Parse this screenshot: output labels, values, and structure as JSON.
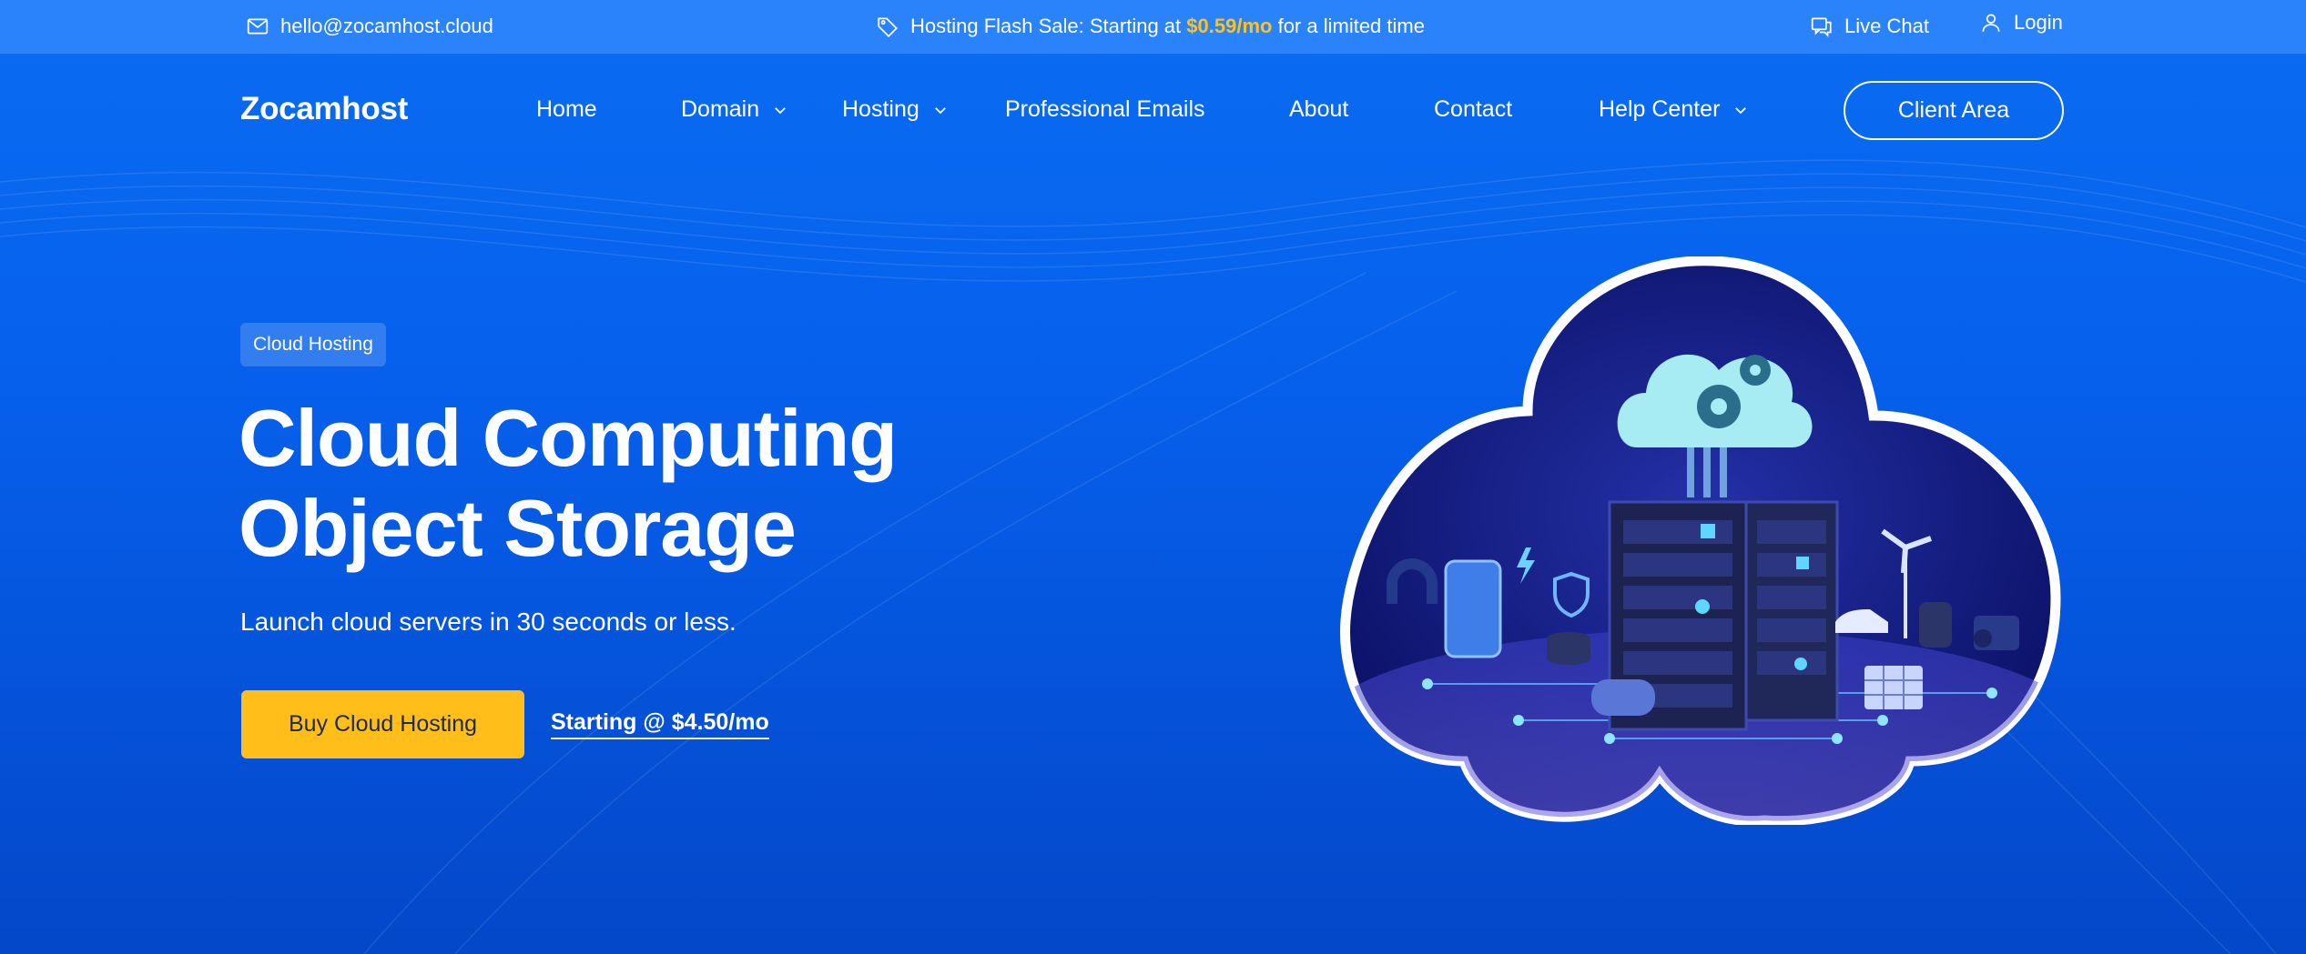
{
  "topbar": {
    "email": "hello@zocamhost.cloud",
    "flash_prefix": "Hosting Flash Sale: Starting at",
    "flash_price": "$0.59/mo",
    "flash_suffix": "for a limited time",
    "live_chat": "Live Chat",
    "login": "Login"
  },
  "header": {
    "logo": "Zocamhost",
    "nav": [
      {
        "label": "Home"
      },
      {
        "label": "Domain"
      },
      {
        "label": "Hosting"
      },
      {
        "label": "Professional Emails"
      },
      {
        "label": "About"
      },
      {
        "label": "Contact"
      },
      {
        "label": "Help Center"
      }
    ],
    "client_area": "Client Area"
  },
  "hero": {
    "badge": "Cloud Hosting",
    "title_line1": "Cloud Computing",
    "title_line2": "Object Storage",
    "subtitle": "Launch cloud servers in 30 seconds or less.",
    "buy_button": "Buy Cloud Hosting",
    "starting_link": "Starting @ $4.50/mo"
  },
  "colors": {
    "topbar": "#2a83fb",
    "background": "#0a6cf2",
    "accent": "#ffbe1a",
    "price_highlight": "#ffc21a"
  },
  "icons": [
    "mail-icon",
    "tag-icon",
    "chat-icon",
    "user-icon",
    "chevron-down-icon"
  ]
}
